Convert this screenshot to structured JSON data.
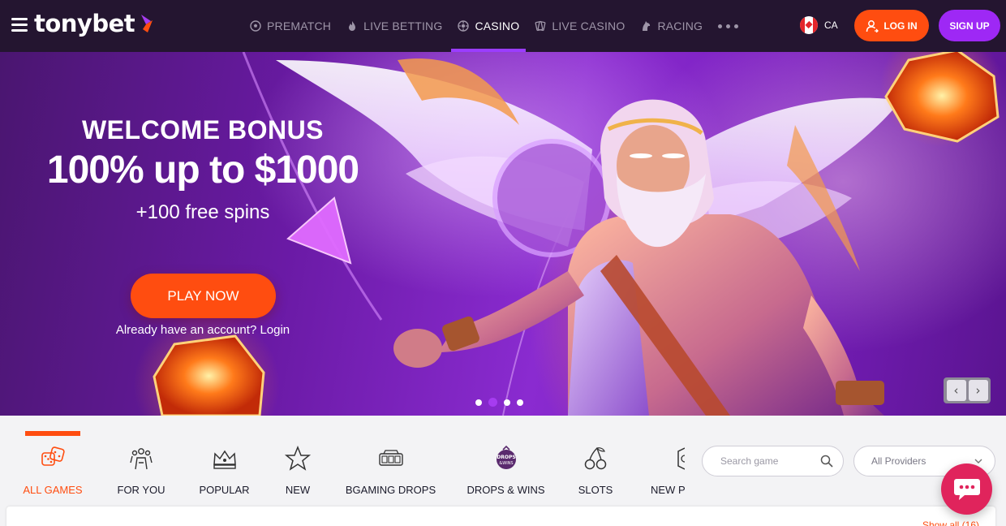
{
  "header": {
    "logo_text": "tonybet",
    "nav": [
      {
        "label": "PREMATCH",
        "icon": "soccer-ball-icon"
      },
      {
        "label": "LIVE BETTING",
        "icon": "fire-icon"
      },
      {
        "label": "CASINO",
        "icon": "roulette-icon",
        "active": true
      },
      {
        "label": "LIVE CASINO",
        "icon": "cards-icon"
      },
      {
        "label": "RACING",
        "icon": "horse-icon"
      }
    ],
    "more_icon": "more-dots-icon",
    "country_code": "CA",
    "login_label": "LOG IN",
    "signup_label": "SIGN UP"
  },
  "hero": {
    "line1": "WELCOME BONUS",
    "line2": "100% up to $1000",
    "line3": "+100 free spins",
    "cta_label": "PLAY NOW",
    "login_prompt": "Already have an account? Login",
    "slides_count": 4,
    "active_slide": 2,
    "prev_label": "‹",
    "next_label": "›"
  },
  "categories": [
    {
      "label": "ALL GAMES",
      "icon": "dice-icon",
      "active": true
    },
    {
      "label": "FOR YOU",
      "icon": "crowd-icon"
    },
    {
      "label": "POPULAR",
      "icon": "crown-icon"
    },
    {
      "label": "NEW",
      "icon": "star-icon"
    },
    {
      "label": "BGAMING DROPS",
      "icon": "slot-machine-icon"
    },
    {
      "label": "DROPS & WINS",
      "icon": "drops-wins-icon"
    },
    {
      "label": "SLOTS",
      "icon": "cherries-icon"
    },
    {
      "label": "NEW PI",
      "icon": "partial-icon"
    }
  ],
  "search": {
    "placeholder": "Search game"
  },
  "providers": {
    "selected": "All Providers"
  },
  "games": {
    "show_all": "Show all (16)"
  },
  "colors": {
    "header_bg": "#241530",
    "accent_orange": "#ff4d10",
    "accent_purple": "#9e28f5",
    "chat_pink": "#e0245c"
  }
}
